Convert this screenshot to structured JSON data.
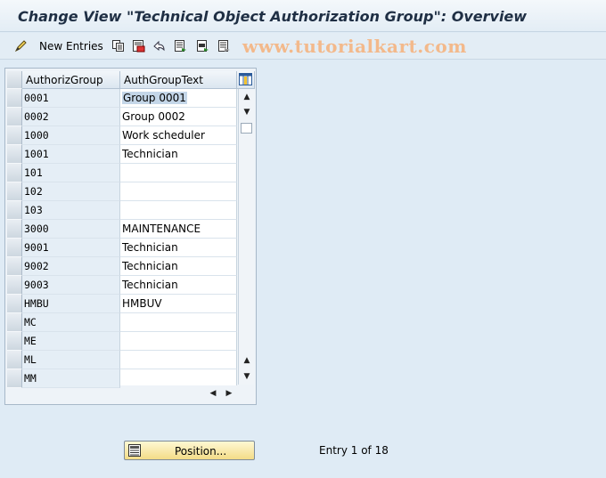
{
  "window": {
    "title": "Change View \"Technical Object Authorization Group\": Overview"
  },
  "toolbar": {
    "new_entries_label": "New Entries",
    "icons": [
      "display-change-icon",
      "copy-icon",
      "delete-icon",
      "undo-icon",
      "select-all-icon",
      "select-block-icon",
      "deselect-all-icon"
    ]
  },
  "watermark": {
    "text": "www.tutorialkart.com"
  },
  "table": {
    "columns": [
      "AuthorizGroup",
      "AuthGroupText"
    ],
    "rows": [
      {
        "key": "0001",
        "text": "Group 0001"
      },
      {
        "key": "0002",
        "text": "Group 0002"
      },
      {
        "key": "1000",
        "text": "Work scheduler"
      },
      {
        "key": "1001",
        "text": "Technician"
      },
      {
        "key": "101",
        "text": ""
      },
      {
        "key": "102",
        "text": ""
      },
      {
        "key": "103",
        "text": ""
      },
      {
        "key": "3000",
        "text": "MAINTENANCE"
      },
      {
        "key": "9001",
        "text": "Technician"
      },
      {
        "key": "9002",
        "text": "Technician"
      },
      {
        "key": "9003",
        "text": "Technician"
      },
      {
        "key": "HMBU",
        "text": "HMBUV"
      },
      {
        "key": "MC",
        "text": ""
      },
      {
        "key": "ME",
        "text": ""
      },
      {
        "key": "ML",
        "text": ""
      },
      {
        "key": "MM",
        "text": ""
      }
    ],
    "selected_row_index": 0
  },
  "footer": {
    "position_button_label": "Position...",
    "entry_info": "Entry 1 of 18"
  },
  "colors": {
    "background": "#dfebf5",
    "title_text": "#1f2f44",
    "watermark": "#f3b98b",
    "button_yellow": "#f3dc87"
  }
}
